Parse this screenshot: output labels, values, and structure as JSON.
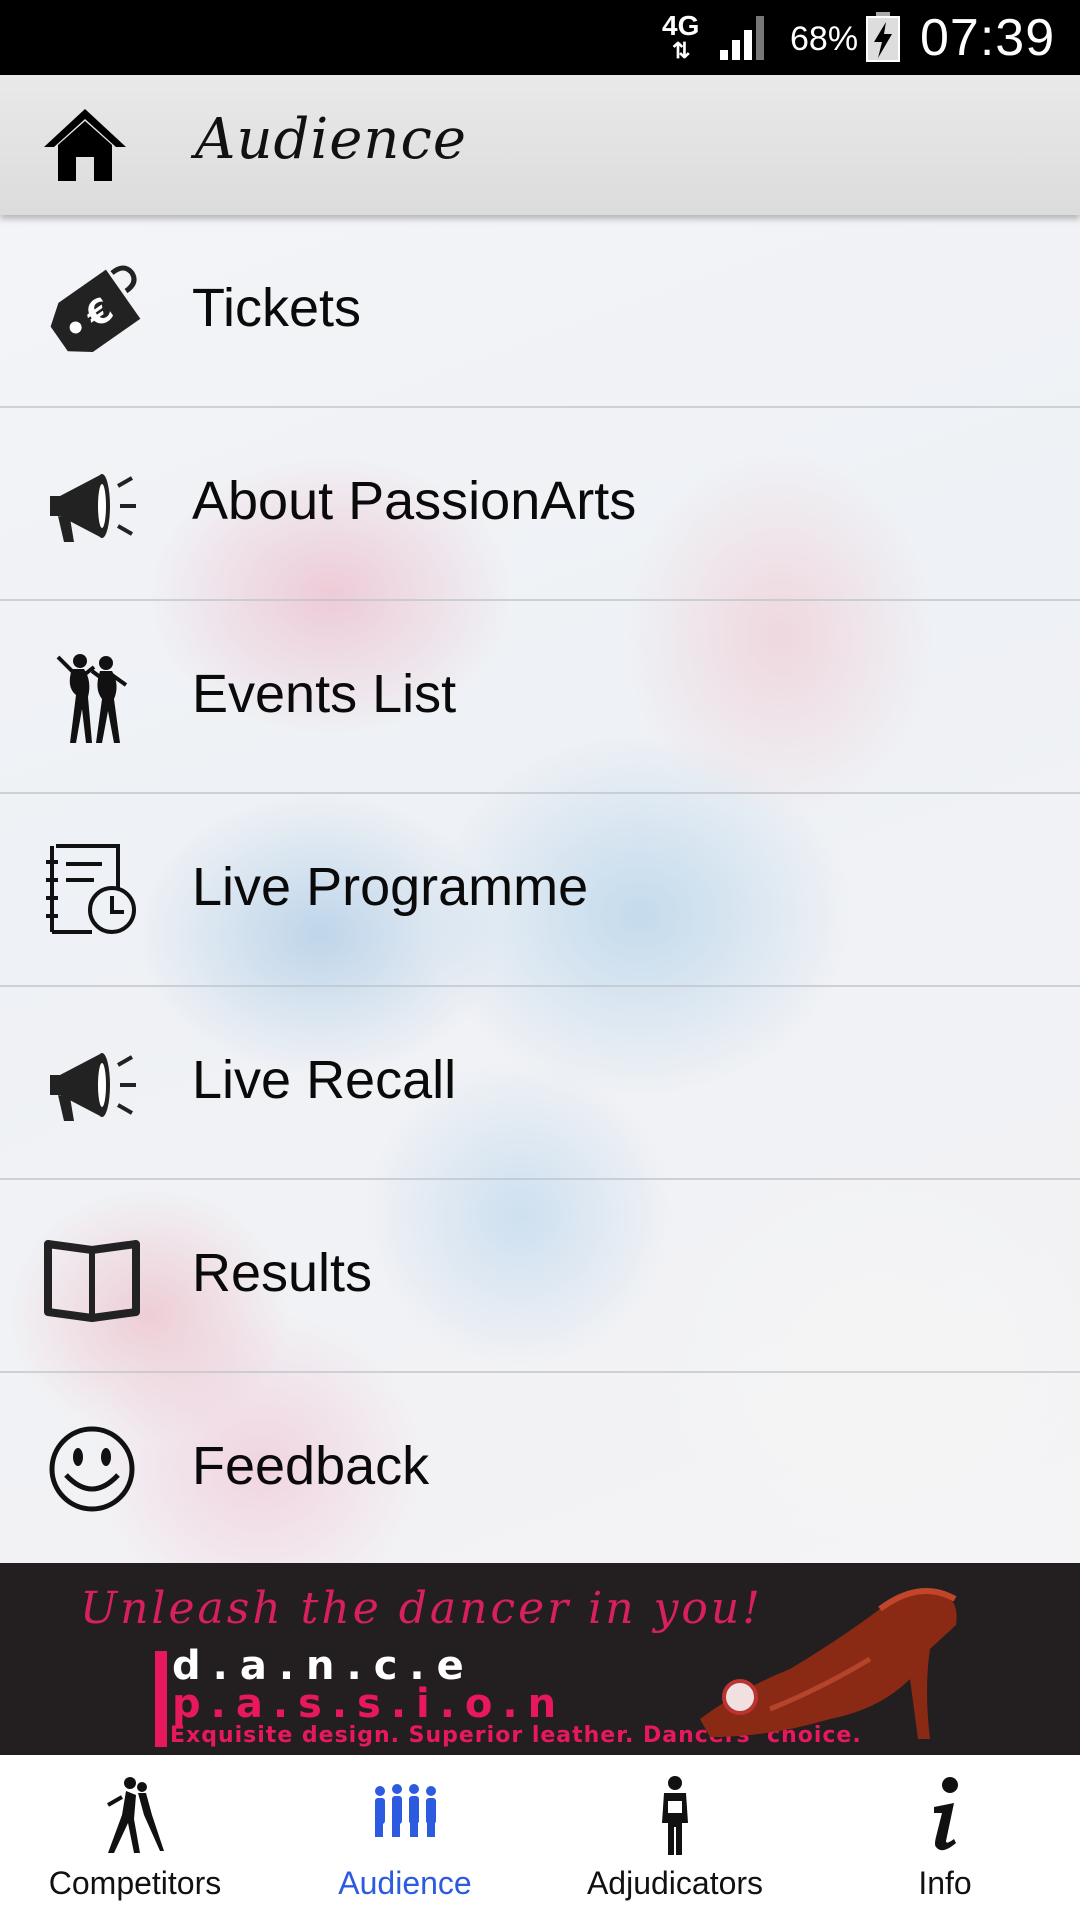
{
  "status_bar": {
    "network": "4G",
    "battery_percent": "68%",
    "time": "07:39"
  },
  "header": {
    "title": "Audience",
    "home_icon": "home-icon"
  },
  "menu": {
    "items": [
      {
        "label": "Tickets",
        "icon": "ticket-tag-icon"
      },
      {
        "label": "About PassionArts",
        "icon": "megaphone-icon"
      },
      {
        "label": "Events List",
        "icon": "dancers-icon"
      },
      {
        "label": "Live Programme",
        "icon": "schedule-clock-icon"
      },
      {
        "label": "Live Recall",
        "icon": "megaphone-icon"
      },
      {
        "label": "Results",
        "icon": "open-book-icon"
      },
      {
        "label": "Feedback",
        "icon": "smiley-icon"
      }
    ]
  },
  "banner": {
    "tagline": "Unleash the dancer in you!",
    "brand_line1": "d.a.n.c.e",
    "brand_line2": "p.a.s.s.i.o.n",
    "slogan": "Exquisite design. Superior leather. Dancers' choice."
  },
  "bottom_nav": {
    "tabs": [
      {
        "label": "Competitors",
        "icon": "dancing-couple-icon",
        "active": false
      },
      {
        "label": "Audience",
        "icon": "audience-group-icon",
        "active": true
      },
      {
        "label": "Adjudicators",
        "icon": "adjudicator-icon",
        "active": false
      },
      {
        "label": "Info",
        "icon": "info-icon",
        "active": false
      }
    ]
  },
  "colors": {
    "active_tab": "#2d5be0",
    "banner_pink": "#e8185c",
    "banner_bg": "#231f20"
  }
}
